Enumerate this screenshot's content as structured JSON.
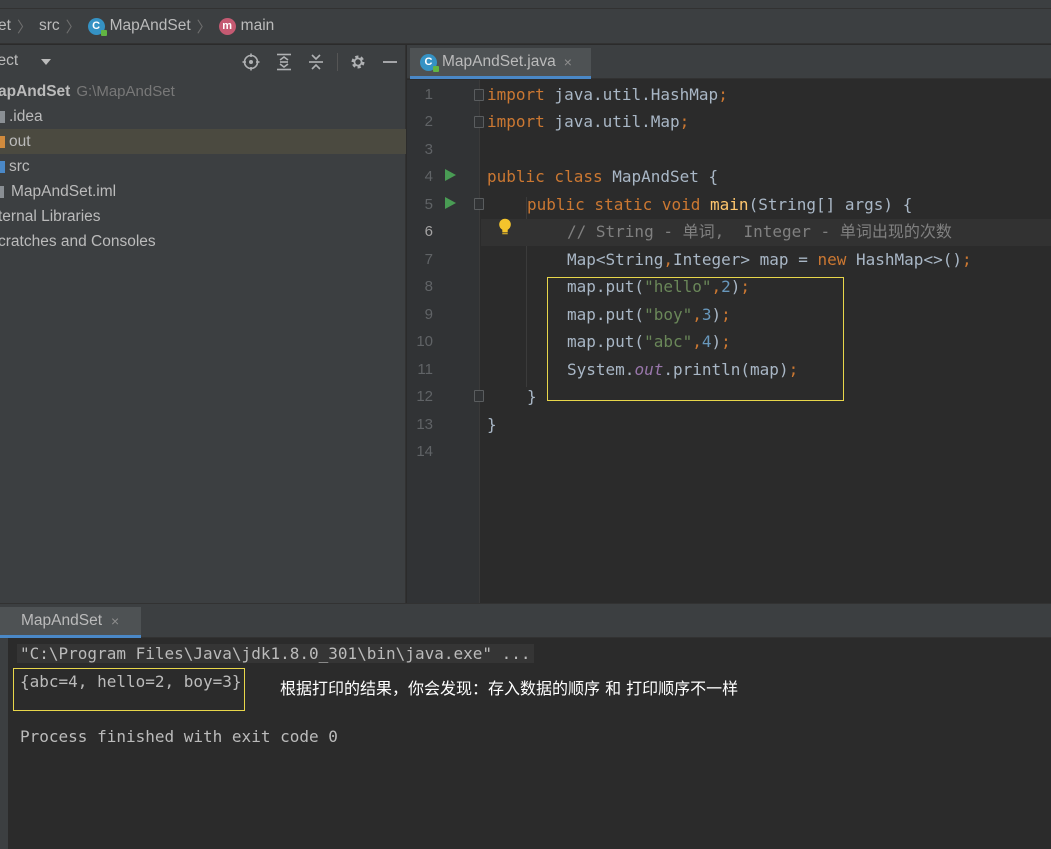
{
  "breadcrumb": {
    "items": [
      "et",
      "src",
      "MapAndSet",
      "main"
    ]
  },
  "project_panel": {
    "title": "ject",
    "tree": [
      {
        "label": "apAndSet",
        "path": "G:\\MapAndSet",
        "bold": true
      },
      {
        "label": ".idea"
      },
      {
        "label": "out",
        "selected": true
      },
      {
        "label": "src"
      },
      {
        "label": "MapAndSet.iml"
      },
      {
        "label": "ternal Libraries"
      },
      {
        "label": "cratches and Consoles"
      }
    ]
  },
  "editor": {
    "tab_label": "MapAndSet.java",
    "tab_close": "×",
    "current_line": 6,
    "line_numbers": [
      "1",
      "2",
      "3",
      "4",
      "5",
      "6",
      "7",
      "8",
      "9",
      "10",
      "11",
      "12",
      "13",
      "14"
    ],
    "lines": {
      "l1_kw": "import",
      "l1_rest": " java.util.HashMap",
      "l1_semi": ";",
      "l2_kw": "import",
      "l2_rest": " java.util.Map",
      "l2_semi": ";",
      "l4_kw": "public class",
      "l4_rest": " MapAndSet {",
      "l5_kw": "public static void",
      "l5_fn": "main",
      "l5_rest": "(String[] args) {",
      "l6_comment": "// String - 单词,  Integer - 单词出现的次数",
      "l7_a": "Map<String",
      "l7_comma": ",",
      "l7_b": "Integer> map = ",
      "l7_new": "new",
      "l7_c": " HashMap<>()",
      "l7_semi": ";",
      "l8_a": "map.put(",
      "l8_str": "\"hello\"",
      "l8_comma": ",",
      "l8_num": "2",
      "l8_b": ")",
      "l8_semi": ";",
      "l9_a": "map.put(",
      "l9_str": "\"boy\"",
      "l9_comma": ",",
      "l9_num": "3",
      "l9_b": ")",
      "l9_semi": ";",
      "l10_a": "map.put(",
      "l10_str": "\"abc\"",
      "l10_comma": ",",
      "l10_num": "4",
      "l10_b": ")",
      "l10_semi": ";",
      "l11_a": "System.",
      "l11_out": "out",
      "l11_b": ".println(map)",
      "l11_semi": ";",
      "l12": "}",
      "l13": "}"
    }
  },
  "run_panel": {
    "tab_label": "MapAndSet",
    "tab_close": "×",
    "command": "\"C:\\Program Files\\Java\\jdk1.8.0_301\\bin\\java.exe\" ...",
    "output": "{abc=4, hello=2, boy=3}",
    "exit_message": "Process finished with exit code 0",
    "annotation": "根据打印的结果，你会发现：存入数据的顺序 和 打印顺序不一样"
  },
  "colors": {
    "keyword": "#cc7832",
    "string": "#6a8759",
    "number": "#6897bb",
    "comment": "#808080",
    "method": "#ffc66d",
    "highlight_box": "#e8d64a"
  },
  "icons": [
    "class-icon",
    "method-icon",
    "locate-icon",
    "expand-all-icon",
    "collapse-all-icon",
    "gear-icon",
    "minimize-icon",
    "run-gutter-icon",
    "bulb-icon",
    "fold-icon",
    "folder-icon"
  ]
}
